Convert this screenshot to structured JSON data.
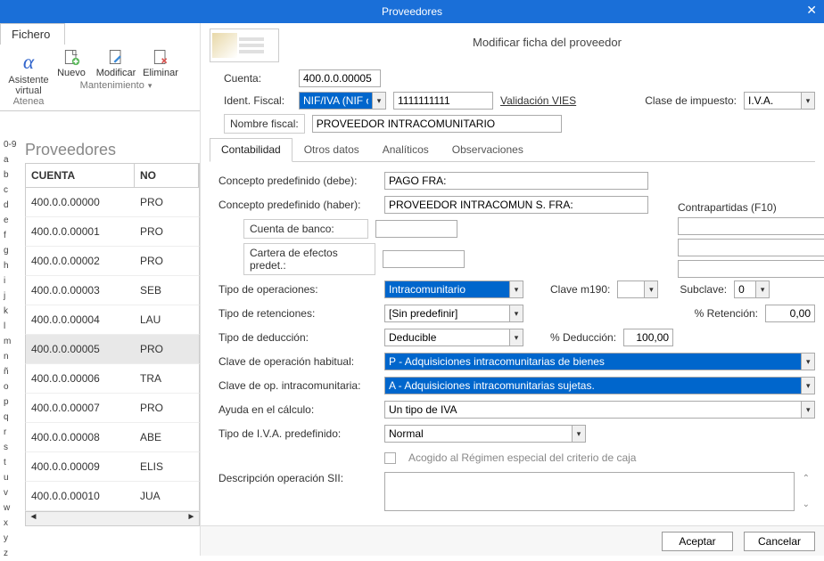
{
  "window": {
    "title": "Proveedores"
  },
  "ribbon": {
    "file_tab": "Fichero",
    "assistant": "Asistente virtual",
    "assistant_sub": "Atenea",
    "new": "Nuevo",
    "edit": "Modificar",
    "del": "Eliminar",
    "maint": "Mantenimiento"
  },
  "modal": {
    "subtitle": "Modificar ficha del proveedor",
    "cuenta_label": "Cuenta:",
    "cuenta_value": "400.0.0.00005",
    "idfiscal_label": "Ident. Fiscal:",
    "idfiscal_type": "NIF/IVA (NIF ope",
    "idfiscal_value": "1111111111",
    "vies": "Validación VIES",
    "clase_label": "Clase de impuesto:",
    "clase_value": "I.V.A.",
    "nombre_label": "Nombre fiscal:",
    "nombre_value": "PROVEEDOR INTRACOMUNITARIO"
  },
  "tabs": {
    "t1": "Contabilidad",
    "t2": "Otros datos",
    "t3": "Analíticos",
    "t4": "Observaciones"
  },
  "fields": {
    "concepto_debe_l": "Concepto predefinido (debe):",
    "concepto_debe_v": "PAGO FRA:",
    "concepto_haber_l": "Concepto predefinido (haber):",
    "concepto_haber_v": "PROVEEDOR INTRACOMUN S. FRA:",
    "cuenta_banco_l": "Cuenta de banco:",
    "cartera_l": "Cartera de efectos predet.:",
    "tipo_op_l": "Tipo de operaciones:",
    "tipo_op_v": "Intracomunitario",
    "clave190_l": "Clave m190:",
    "subclave_l": "Subclave:",
    "subclave_v": "0",
    "tipo_ret_l": "Tipo de retenciones:",
    "tipo_ret_v": "[Sin predefinir]",
    "pct_ret_l": "% Retención:",
    "pct_ret_v": "0,00",
    "tipo_ded_l": "Tipo de deducción:",
    "tipo_ded_v": "Deducible",
    "pct_ded_l": "% Deducción:",
    "pct_ded_v": "100,00",
    "clave_hab_l": "Clave de operación habitual:",
    "clave_hab_v": "P - Adquisiciones intracomunitarias de bienes",
    "clave_intra_l": "Clave de op. intracomunitaria:",
    "clave_intra_v": "A - Adquisiciones intracomunitarias sujetas.",
    "ayuda_l": "Ayuda en el cálculo:",
    "ayuda_v": "Un tipo de IVA",
    "tipo_iva_l": "Tipo de I.V.A. predefinido:",
    "tipo_iva_v": "Normal",
    "criterio_caja": "Acogido al Régimen especial del criterio de caja",
    "desc_sii_l": "Descripción operación SII:",
    "contrap_l": "Contrapartidas (F10)"
  },
  "buttons": {
    "accept": "Aceptar",
    "cancel": "Cancelar"
  },
  "grid": {
    "title": "Proveedores",
    "col1": "CUENTA",
    "col2": "NO",
    "rows": [
      {
        "c": "400.0.0.00000",
        "n": "PRO"
      },
      {
        "c": "400.0.0.00001",
        "n": "PRO"
      },
      {
        "c": "400.0.0.00002",
        "n": "PRO"
      },
      {
        "c": "400.0.0.00003",
        "n": "SEB"
      },
      {
        "c": "400.0.0.00004",
        "n": "LAU"
      },
      {
        "c": "400.0.0.00005",
        "n": "PRO"
      },
      {
        "c": "400.0.0.00006",
        "n": "TRA"
      },
      {
        "c": "400.0.0.00007",
        "n": "PRO"
      },
      {
        "c": "400.0.0.00008",
        "n": "ABE"
      },
      {
        "c": "400.0.0.00009",
        "n": "ELIS"
      },
      {
        "c": "400.0.0.00010",
        "n": "JUA"
      }
    ]
  },
  "alpha": [
    "0-9",
    "a",
    "b",
    "c",
    "d",
    "e",
    "f",
    "g",
    "h",
    "i",
    "j",
    "k",
    "l",
    "m",
    "n",
    "ñ",
    "o",
    "p",
    "q",
    "r",
    "s",
    "t",
    "u",
    "v",
    "w",
    "x",
    "y",
    "z"
  ]
}
